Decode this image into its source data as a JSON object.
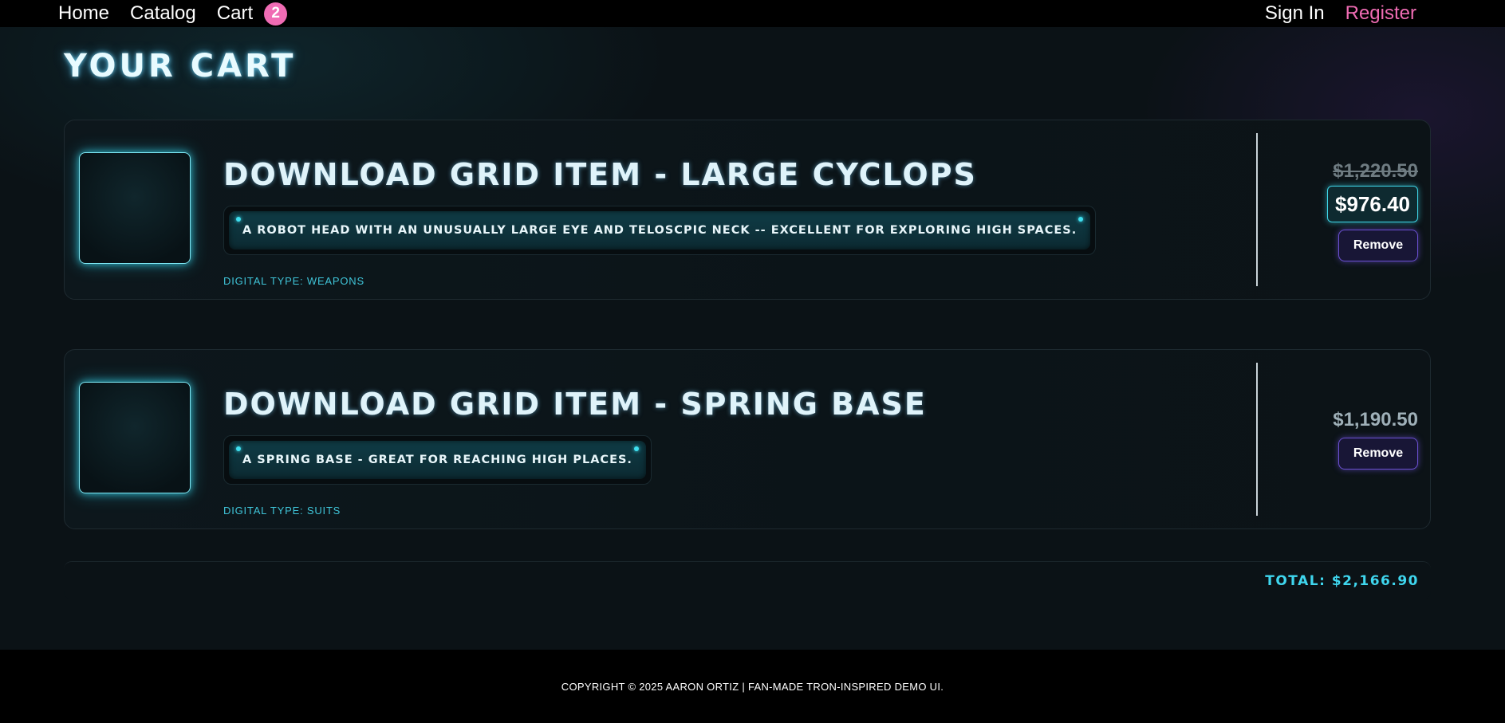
{
  "nav": {
    "home": "Home",
    "catalog": "Catalog",
    "cart": "Cart",
    "cart_count": "2",
    "sign_in": "Sign In",
    "register": "Register"
  },
  "page": {
    "title": "YOUR CART"
  },
  "items": [
    {
      "title": "DOWNLOAD GRID ITEM - LARGE CYCLOPS",
      "description": "A ROBOT HEAD WITH AN UNUSUALLY LARGE EYE AND TELOSCPIC NECK -- EXCELLENT FOR EXPLORING HIGH SPACES.",
      "digital_type": "DIGITAL TYPE: WEAPONS",
      "original_price": "$1,220.50",
      "sale_price": "$976.40",
      "remove_label": "Remove"
    },
    {
      "title": "DOWNLOAD GRID ITEM - SPRING BASE",
      "description": "A SPRING BASE - GREAT FOR REACHING HIGH PLACES.",
      "digital_type": "DIGITAL TYPE: SUITS",
      "price": "$1,190.50",
      "remove_label": "Remove"
    }
  ],
  "summary": {
    "total": "TOTAL: $2,166.90"
  },
  "footer": {
    "copyright": "COPYRIGHT © 2025 AARON ORTIZ | FAN-MADE TRON-INSPIRED DEMO UI."
  },
  "colors": {
    "accent_cyan": "#3fd6ee",
    "accent_pink": "#f06cb4",
    "accent_purple": "#6a4fd0"
  }
}
